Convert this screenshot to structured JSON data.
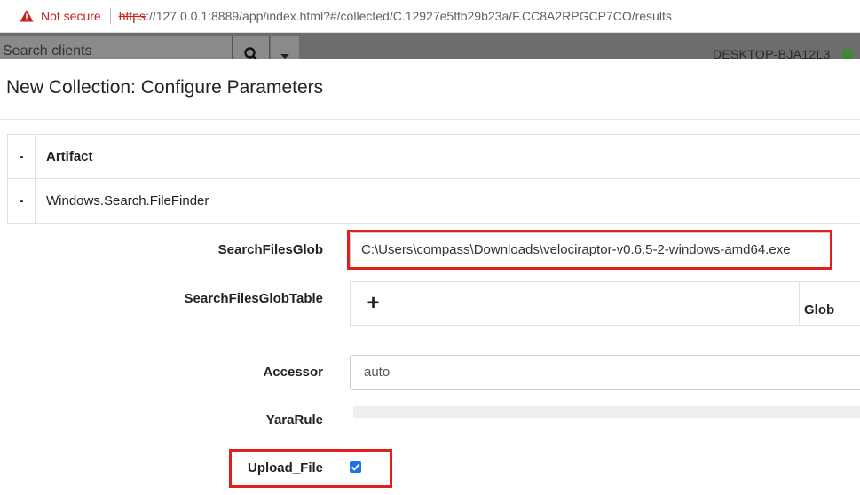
{
  "browser": {
    "security_label": "Not secure",
    "url_scheme": "https",
    "url_rest": "://127.0.0.1:8889/app/index.html?#/collected/C.12927e5ffb29b23a/F.CC8A2RPGCP7CO/results"
  },
  "appbar": {
    "search_placeholder": "Search clients",
    "hostname": "DESKTOP-BJA12L3"
  },
  "modal": {
    "title": "New Collection: Configure Parameters",
    "artifact_table": {
      "header_toggle": "-",
      "header_label": "Artifact",
      "row_toggle": "-",
      "row_label": "Windows.Search.FileFinder"
    },
    "params": {
      "search_files_glob": {
        "label": "SearchFilesGlob",
        "value": "C:\\Users\\compass\\Downloads\\velociraptor-v0.6.5-2-windows-amd64.exe"
      },
      "search_files_glob_table": {
        "label": "SearchFilesGlobTable",
        "add_label": "+",
        "column_header": "Glob"
      },
      "accessor": {
        "label": "Accessor",
        "value": "auto"
      },
      "yara_rule": {
        "label": "YaraRule"
      },
      "upload_file": {
        "label": "Upload_File",
        "checked": true
      }
    }
  },
  "colors": {
    "highlight_red": "#e0201c",
    "checkbox_blue": "#1a73e8",
    "status_green": "#3a8a2c"
  }
}
